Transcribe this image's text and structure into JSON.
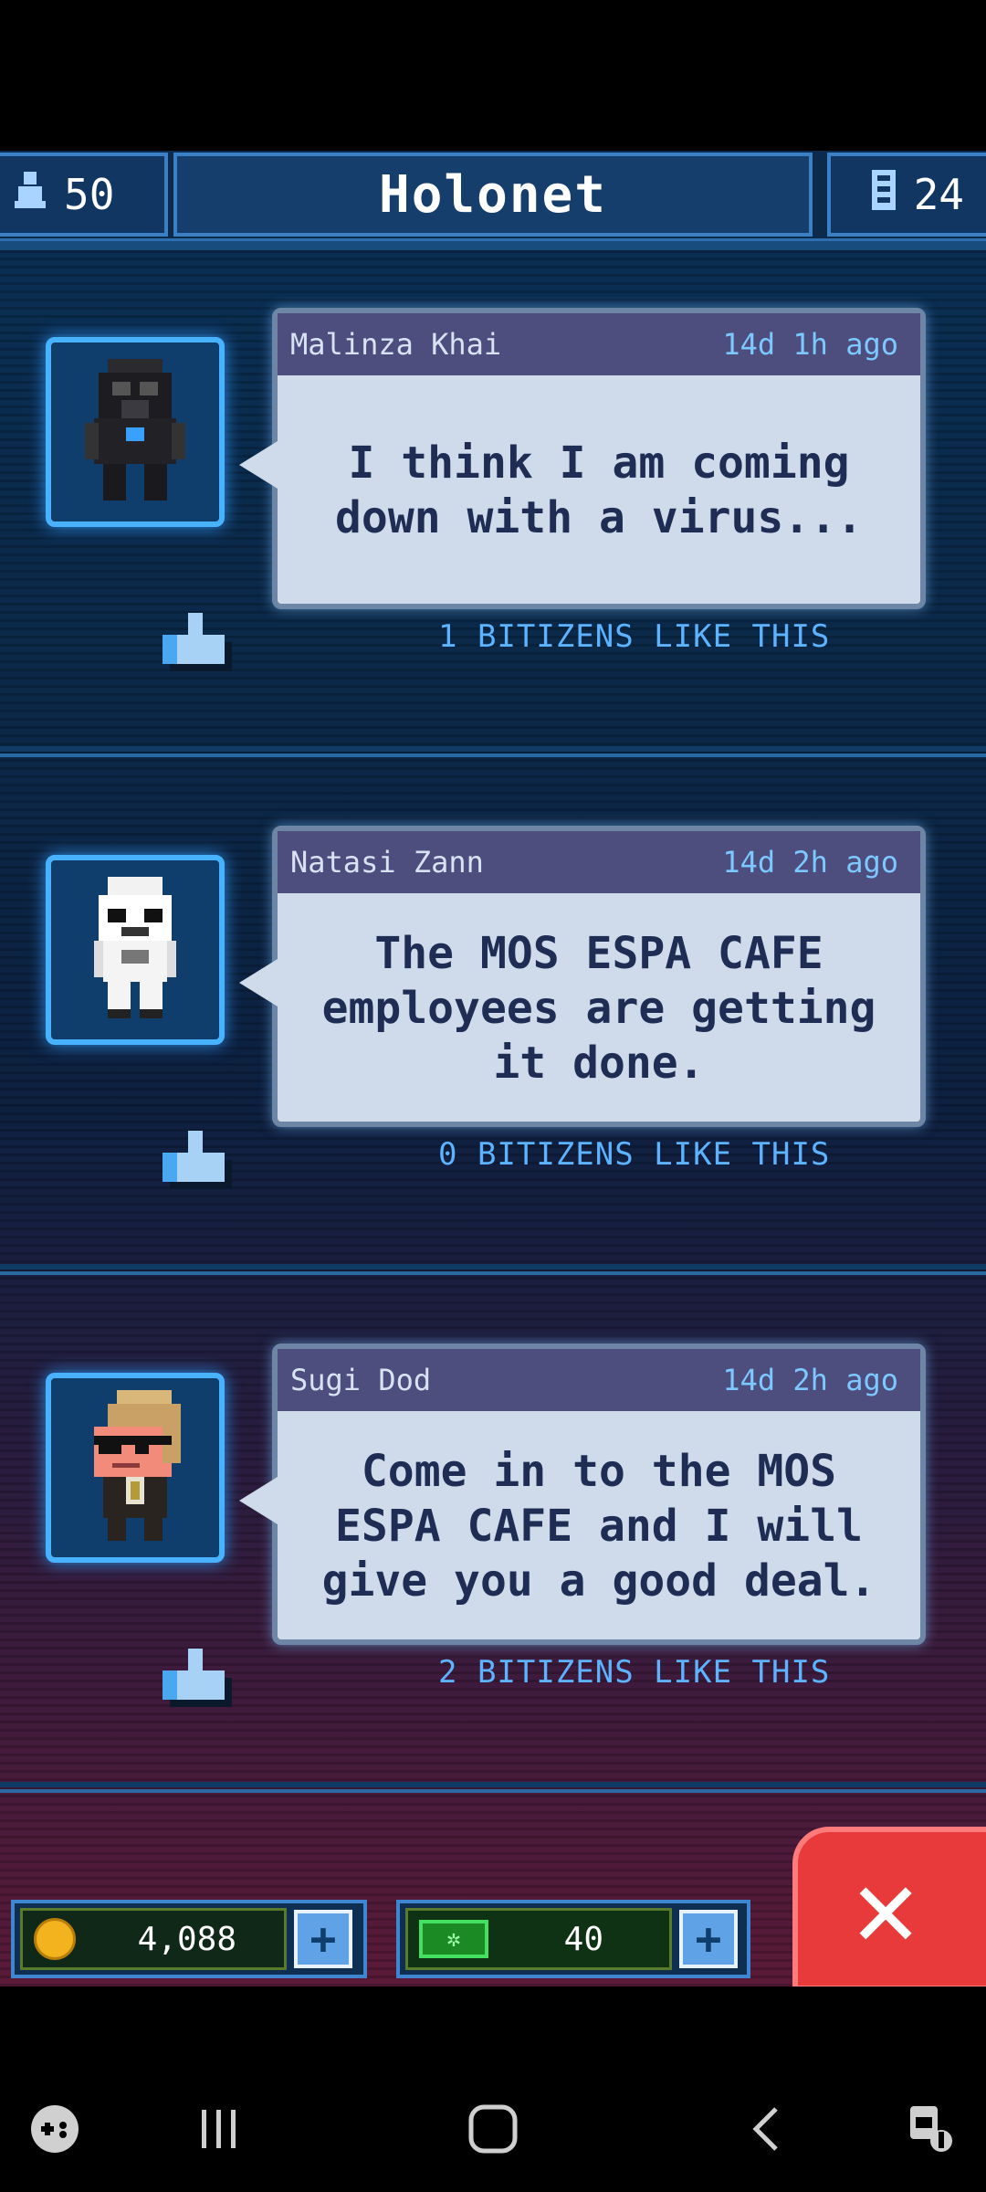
{
  "header": {
    "population": "50",
    "title": "Holonet",
    "floors": "24",
    "population_icon": "person-icon",
    "floors_icon": "building-icon"
  },
  "posts": [
    {
      "author": "Malinza Khai",
      "time": "14d 1h ago",
      "message": "I think I am coming down with a virus...",
      "likes": "1 BITIZENS LIKE THIS",
      "avatar": "tie-pilot"
    },
    {
      "author": "Natasi Zann",
      "time": "14d 2h ago",
      "message": "The MOS ESPA CAFE employees are getting it done.",
      "likes": "0 BITIZENS LIKE THIS",
      "avatar": "stormtrooper"
    },
    {
      "author": "Sugi Dod",
      "time": "14d 2h ago",
      "message": "Come in to the MOS ESPA CAFE and I will give you a good deal.",
      "likes": "2 BITIZENS LIKE THIS",
      "avatar": "eyepatch-bitizen"
    }
  ],
  "bottom": {
    "coins": "4,088",
    "credits": "40",
    "credit_icon_text": "✲"
  },
  "colors": {
    "accent": "#3b7fc4",
    "likes_text": "#5db3ff",
    "bubble": "#cfdbea",
    "close": "#e83a3a"
  }
}
